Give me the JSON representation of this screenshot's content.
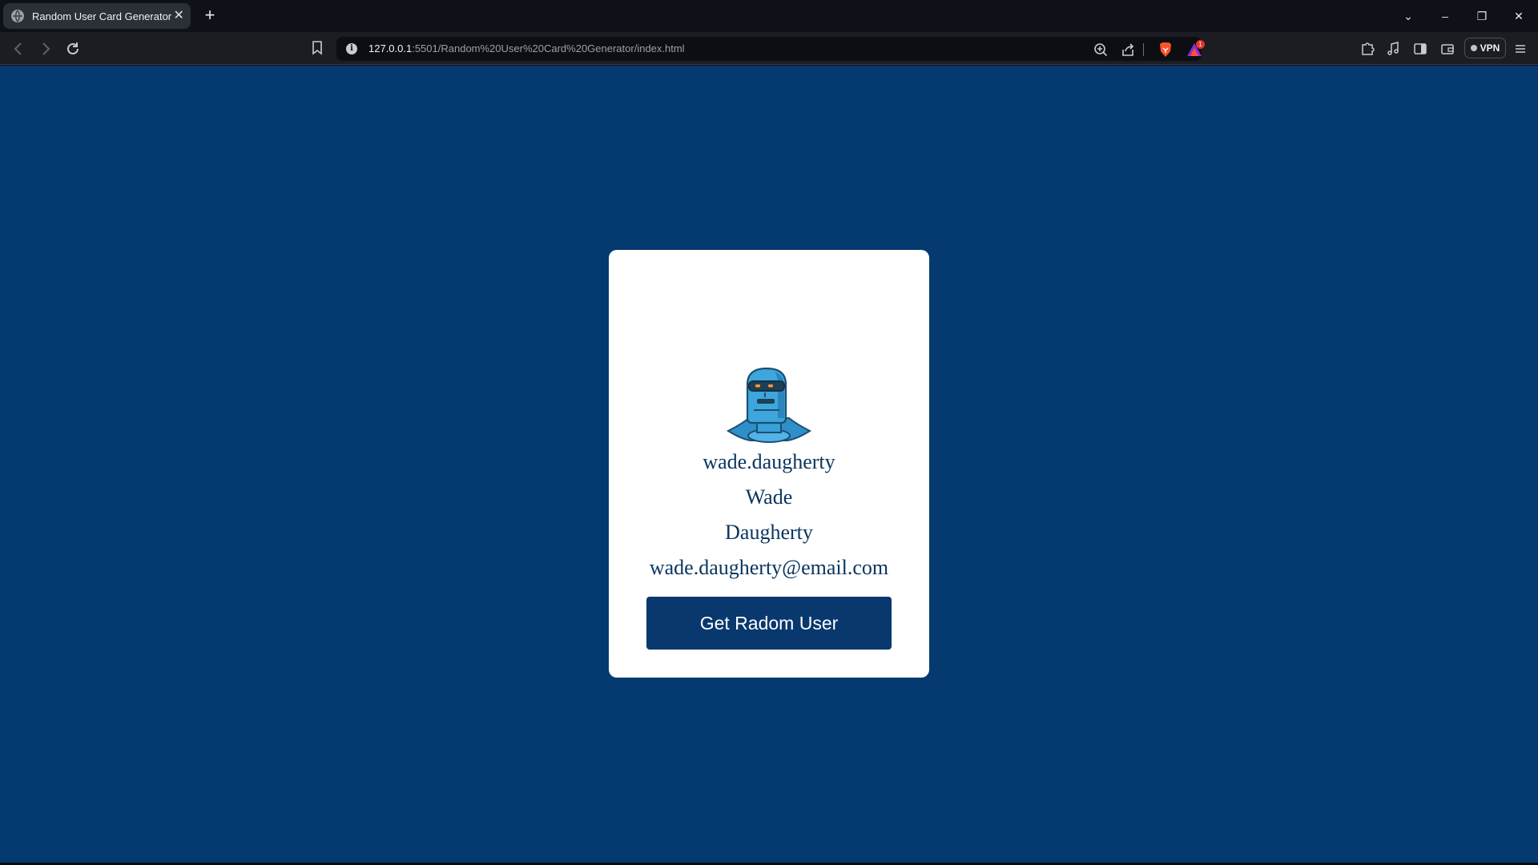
{
  "browser": {
    "tab": {
      "title": "Random User Card Generator",
      "close": "✕"
    },
    "new_tab": "+",
    "window_controls": {
      "tab_search": "⌄",
      "minimize": "–",
      "restore": "❐",
      "close": "✕"
    },
    "url": {
      "host": "127.0.0.1",
      "path": ":5501/Random%20User%20Card%20Generator/index.html"
    },
    "rewards_badge": "1",
    "vpn_label": "VPN"
  },
  "card": {
    "username": "wade.daugherty",
    "first_name": "Wade",
    "last_name": "Daugherty",
    "email": "wade.daugherty@email.com",
    "button_label": "Get Radom User"
  },
  "colors": {
    "page_background": "#043a70",
    "card_background": "#ffffff",
    "button_background": "#08386d",
    "text": "#0c3660"
  },
  "icons": [
    "globe-icon",
    "close-icon",
    "plus-icon",
    "back-icon",
    "forward-icon",
    "reload-icon",
    "bookmark-icon",
    "info-icon",
    "zoom-icon",
    "share-icon",
    "brave-shields-icon",
    "rewards-icon",
    "extensions-icon",
    "music-icon",
    "sidebar-icon",
    "wallet-icon",
    "menu-icon",
    "robot-avatar"
  ]
}
